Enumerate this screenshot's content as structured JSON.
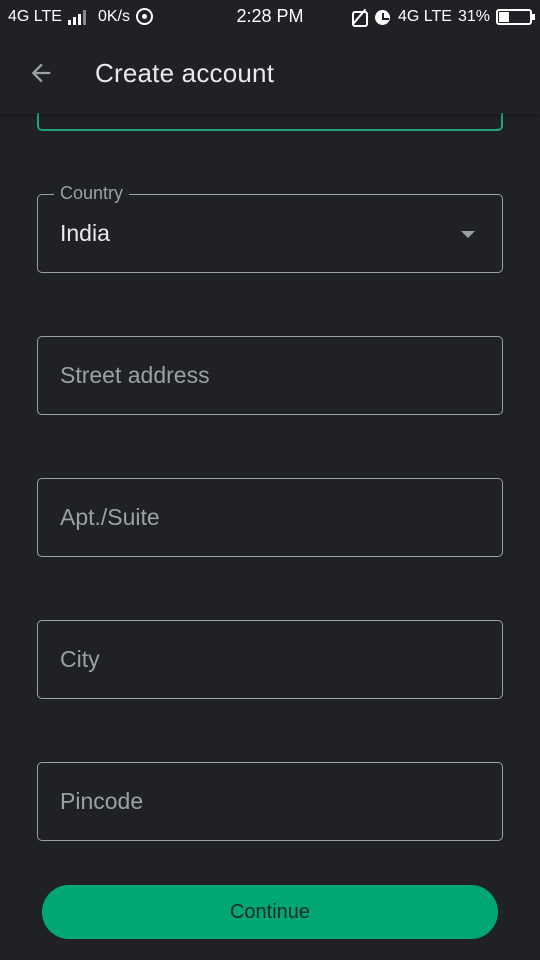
{
  "status_bar": {
    "network_left": "4G LTE",
    "speed": "0K/s",
    "time": "2:28 PM",
    "network_right": "4G LTE",
    "battery_percent": "31%",
    "battery_level": 0.31
  },
  "app_bar": {
    "title": "Create account",
    "back_icon": "arrow-back-icon"
  },
  "form": {
    "country": {
      "label": "Country",
      "value": "India",
      "icon": "dropdown-arrow-icon"
    },
    "street": {
      "placeholder": "Street address"
    },
    "apt": {
      "placeholder": "Apt./Suite"
    },
    "city": {
      "placeholder": "City"
    },
    "pincode": {
      "placeholder": "Pincode"
    },
    "continue_label": "Continue"
  },
  "colors": {
    "background": "#202124",
    "accent": "#01a675",
    "focused_border": "#1ea37d",
    "field_border": "#9aa0a6"
  }
}
